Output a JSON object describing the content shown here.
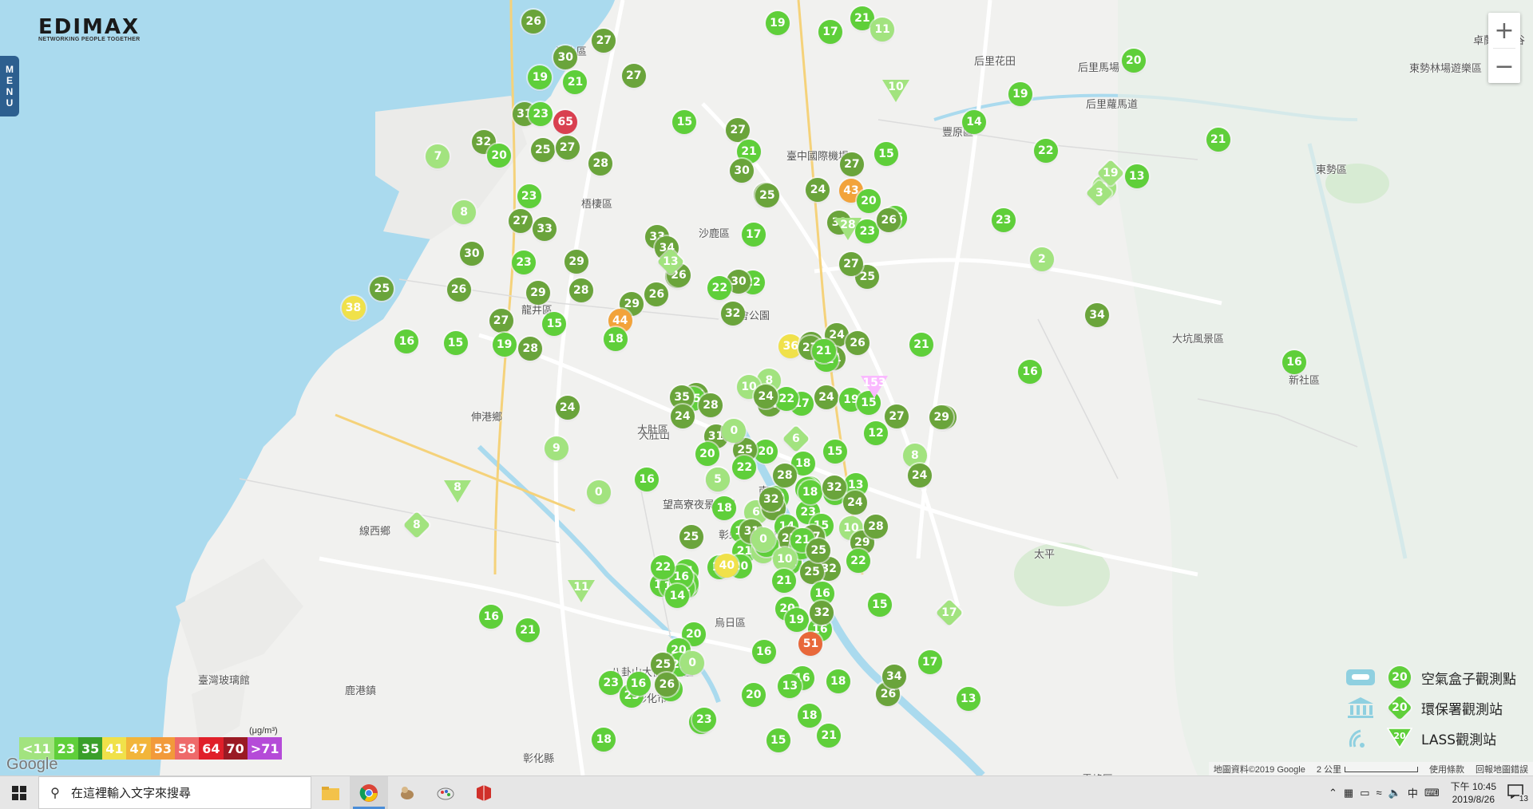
{
  "logo": {
    "brand": "EDIMAX",
    "tagline": "NETWORKING PEOPLE TOGETHER"
  },
  "menu_tab": {
    "label": [
      "M",
      "E",
      "N",
      "U"
    ]
  },
  "zoom": {
    "in": "+",
    "out": "−"
  },
  "places": [
    "清水區",
    "后里花田",
    "后里馬場",
    "后里蘿馬道",
    "卓蘭大峽谷",
    "東勢林場遊樂區",
    "臺中國際機場",
    "梧棲區",
    "沙鹿區",
    "都會公園",
    "大肚山",
    "龍井區",
    "伸港鄉",
    "線西鄉",
    "彰化市",
    "鹿港鎮",
    "臺灣玻璃館",
    "大肚區",
    "望高寮夜景公園",
    "彰虹村 Rainbow Village",
    "東勢區",
    "新社區",
    "大坑風景區",
    "霧峰區",
    "彰化縣",
    "南",
    "太平",
    "八卦山大佛風景區",
    "烏日區",
    "豐原區"
  ],
  "legend": {
    "items": [
      {
        "label": "空氣盒子觀測點",
        "value": "20"
      },
      {
        "label": "環保署觀測站",
        "value": "20"
      },
      {
        "label": "LASS觀測站",
        "value": "20"
      }
    ]
  },
  "aqi_scale": {
    "unit": "(μg/m³)",
    "levels": [
      {
        "label": "<11",
        "color": "#a2e37f"
      },
      {
        "label": "23",
        "color": "#5fcf3a"
      },
      {
        "label": "35",
        "color": "#3a9f2a"
      },
      {
        "label": "41",
        "color": "#f0e14a"
      },
      {
        "label": "47",
        "color": "#f2b53a"
      },
      {
        "label": "53",
        "color": "#f29a3a"
      },
      {
        "label": "58",
        "color": "#ee6a6a"
      },
      {
        "label": "64",
        "color": "#e0202a"
      },
      {
        "label": "70",
        "color": "#9a1a24"
      },
      {
        "label": ">71",
        "color": "#b54bd8"
      }
    ]
  },
  "google_logo": "Google",
  "attribution": {
    "data": "地圖資料©2019 Google",
    "scale": "2 公里",
    "terms": "使用條款",
    "report": "回報地圖錯誤"
  },
  "markers": [
    {
      "v": "26",
      "c": 3
    },
    {
      "v": "27",
      "c": 3
    },
    {
      "v": "30",
      "c": 3
    },
    {
      "v": "19",
      "c": 2
    },
    {
      "v": "27",
      "c": 3
    },
    {
      "v": "21",
      "c": 2
    },
    {
      "v": "19",
      "c": 2
    },
    {
      "v": "17",
      "c": 2
    },
    {
      "v": "21",
      "c": 2
    },
    {
      "v": "11",
      "c": 1
    },
    {
      "v": "20",
      "c": 2
    },
    {
      "v": "31",
      "c": 3
    },
    {
      "v": "23",
      "c": 2
    },
    {
      "v": "65",
      "c": 8
    },
    {
      "v": "7",
      "c": 1
    },
    {
      "v": "32",
      "c": 3
    },
    {
      "v": "20",
      "c": 2
    },
    {
      "v": "25",
      "c": 3
    },
    {
      "v": "27",
      "c": 3
    },
    {
      "v": "28",
      "c": 3
    },
    {
      "v": "15",
      "c": 2
    },
    {
      "v": "27",
      "c": 3
    },
    {
      "v": "21",
      "c": 2
    },
    {
      "v": "30",
      "c": 3
    },
    {
      "v": "25",
      "c": 3
    },
    {
      "v": "27",
      "c": 3
    },
    {
      "v": "15",
      "c": 2
    },
    {
      "v": "15",
      "c": 2
    },
    {
      "v": "43",
      "c": 5
    },
    {
      "v": "20",
      "c": 2
    },
    {
      "v": "24",
      "c": 3
    },
    {
      "v": "19",
      "c": 2
    },
    {
      "v": "14",
      "c": 2
    },
    {
      "v": "22",
      "c": 2
    },
    {
      "v": "21",
      "c": 2
    },
    {
      "v": "13",
      "c": 2
    },
    {
      "v": "0",
      "c": 1
    },
    {
      "v": "8",
      "c": 1
    },
    {
      "v": "23",
      "c": 2
    },
    {
      "v": "25",
      "c": 3
    },
    {
      "v": "27",
      "c": 3
    },
    {
      "v": "33",
      "c": 3
    },
    {
      "v": "33",
      "c": 3
    },
    {
      "v": "34",
      "c": 3
    },
    {
      "v": "17",
      "c": 2
    },
    {
      "v": "23",
      "c": 2
    },
    {
      "v": "26",
      "c": 3
    },
    {
      "v": "32",
      "c": 3
    },
    {
      "v": "25",
      "c": 3
    },
    {
      "v": "23",
      "c": 2
    },
    {
      "v": "30",
      "c": 3
    },
    {
      "v": "23",
      "c": 2
    },
    {
      "v": "29",
      "c": 3
    },
    {
      "v": "28",
      "c": 3
    },
    {
      "v": "30",
      "c": 3
    },
    {
      "v": "22",
      "c": 2
    },
    {
      "v": "30",
      "c": 3
    },
    {
      "v": "22",
      "c": 2
    },
    {
      "v": "27",
      "c": 3
    },
    {
      "v": "2",
      "c": 1
    },
    {
      "v": "26",
      "c": 3
    },
    {
      "v": "29",
      "c": 3
    },
    {
      "v": "25",
      "c": 3
    },
    {
      "v": "38",
      "c": 4
    },
    {
      "v": "26",
      "c": 3
    },
    {
      "v": "26",
      "c": 3
    },
    {
      "v": "29",
      "c": 3
    },
    {
      "v": "27",
      "c": 3
    },
    {
      "v": "44",
      "c": 5
    },
    {
      "v": "32",
      "c": 3
    },
    {
      "v": "34",
      "c": 3
    },
    {
      "v": "16",
      "c": 2
    },
    {
      "v": "15",
      "c": 2
    },
    {
      "v": "19",
      "c": 2
    },
    {
      "v": "28",
      "c": 3
    },
    {
      "v": "15",
      "c": 2
    },
    {
      "v": "18",
      "c": 2
    },
    {
      "v": "36",
      "c": 4
    },
    {
      "v": "28",
      "c": 3
    },
    {
      "v": "24",
      "c": 3
    },
    {
      "v": "26",
      "c": 3
    },
    {
      "v": "31",
      "c": 3
    },
    {
      "v": "21",
      "c": 2
    },
    {
      "v": "16",
      "c": 2
    },
    {
      "v": "16",
      "c": 2
    },
    {
      "v": "24",
      "c": 3
    },
    {
      "v": "26",
      "c": 3
    },
    {
      "v": "15",
      "c": 2
    },
    {
      "v": "8",
      "c": 1
    },
    {
      "v": "34",
      "c": 3
    },
    {
      "v": "35",
      "c": 3
    },
    {
      "v": "28",
      "c": 3
    },
    {
      "v": "17",
      "c": 2
    },
    {
      "v": "24",
      "c": 3
    },
    {
      "v": "19",
      "c": 2
    },
    {
      "v": "15",
      "c": 2
    },
    {
      "v": "27",
      "c": 3
    },
    {
      "v": "25",
      "c": 3
    },
    {
      "v": "29",
      "c": 3
    },
    {
      "v": "9",
      "c": 1
    },
    {
      "v": "24",
      "c": 3
    },
    {
      "v": "31",
      "c": 3
    },
    {
      "v": "20",
      "c": 2
    },
    {
      "v": "25",
      "c": 3
    },
    {
      "v": "20",
      "c": 2
    },
    {
      "v": "22",
      "c": 2
    },
    {
      "v": "15",
      "c": 2
    },
    {
      "v": "12",
      "c": 2
    },
    {
      "v": "8",
      "c": 1
    },
    {
      "v": "18",
      "c": 2
    },
    {
      "v": "22",
      "c": 2
    },
    {
      "v": "16",
      "c": 2
    },
    {
      "v": "0",
      "c": 1
    },
    {
      "v": "25",
      "c": 3
    },
    {
      "v": "5",
      "c": 1
    },
    {
      "v": "28",
      "c": 3
    },
    {
      "v": "23",
      "c": 2
    },
    {
      "v": "21",
      "c": 2
    },
    {
      "v": "10",
      "c": 1
    },
    {
      "v": "24",
      "c": 3
    },
    {
      "v": "13",
      "c": 2
    },
    {
      "v": "19",
      "c": 2
    },
    {
      "v": "23",
      "c": 2
    },
    {
      "v": "6",
      "c": 1
    },
    {
      "v": "18",
      "c": 2
    },
    {
      "v": "25",
      "c": 3
    },
    {
      "v": "32",
      "c": 3
    },
    {
      "v": "15",
      "c": 2
    },
    {
      "v": "16",
      "c": 2
    },
    {
      "v": "21",
      "c": 2
    },
    {
      "v": "14",
      "c": 2
    },
    {
      "v": "31",
      "c": 3
    },
    {
      "v": "8",
      "c": 1
    },
    {
      "v": "27",
      "c": 3
    },
    {
      "v": "22",
      "c": 2
    },
    {
      "v": "9",
      "c": 1
    },
    {
      "v": "21",
      "c": 2
    },
    {
      "v": "23",
      "c": 2
    },
    {
      "v": "16",
      "c": 2
    },
    {
      "v": "32",
      "c": 3
    },
    {
      "v": "32",
      "c": 3
    },
    {
      "v": "24",
      "c": 3
    },
    {
      "v": "29",
      "c": 3
    },
    {
      "v": "28",
      "c": 3
    },
    {
      "v": "22",
      "c": 2
    },
    {
      "v": "27",
      "c": 3
    },
    {
      "v": "25",
      "c": 3
    },
    {
      "v": "21",
      "c": 2
    },
    {
      "v": "20",
      "c": 2
    },
    {
      "v": "21",
      "c": 2
    },
    {
      "v": "24",
      "c": 3
    },
    {
      "v": "10",
      "c": 1
    },
    {
      "v": "0",
      "c": 1
    },
    {
      "v": "21",
      "c": 2
    },
    {
      "v": "20",
      "c": 2
    },
    {
      "v": "19",
      "c": 2
    },
    {
      "v": "16",
      "c": 2
    },
    {
      "v": "16",
      "c": 2
    },
    {
      "v": "51",
      "c": 6
    },
    {
      "v": "15",
      "c": 2
    },
    {
      "v": "18",
      "c": 2
    },
    {
      "v": "18",
      "c": 2
    },
    {
      "v": "17",
      "c": 2
    },
    {
      "v": "20",
      "c": 2
    },
    {
      "v": "16",
      "c": 2
    },
    {
      "v": "16",
      "c": 2
    },
    {
      "v": "21",
      "c": 2
    },
    {
      "v": "19",
      "c": 2
    },
    {
      "v": "16",
      "c": 2
    },
    {
      "v": "40",
      "c": 4
    },
    {
      "v": "14",
      "c": 2
    },
    {
      "v": "22",
      "c": 2
    },
    {
      "v": "20",
      "c": 2
    },
    {
      "v": "18",
      "c": 2
    },
    {
      "v": "16",
      "c": 2
    },
    {
      "v": "16",
      "c": 2
    },
    {
      "v": "15",
      "c": 2
    },
    {
      "v": "18",
      "c": 2
    },
    {
      "v": "17",
      "c": 2
    },
    {
      "v": "16",
      "c": 2
    },
    {
      "v": "21",
      "c": 2
    },
    {
      "v": "13",
      "c": 2
    },
    {
      "v": "18",
      "c": 2
    },
    {
      "v": "16",
      "c": 2
    },
    {
      "v": "21",
      "c": 2
    },
    {
      "v": "23",
      "c": 2
    },
    {
      "v": "20",
      "c": 2
    },
    {
      "v": "21",
      "c": 2
    },
    {
      "v": "19",
      "c": 2
    },
    {
      "v": "13",
      "c": 2
    },
    {
      "v": "0",
      "c": 1
    },
    {
      "v": "25",
      "c": 3
    },
    {
      "v": "23",
      "c": 2
    },
    {
      "v": "23",
      "c": 2
    },
    {
      "v": "26",
      "c": 3
    },
    {
      "v": "32",
      "c": 3
    },
    {
      "v": "26",
      "c": 3
    },
    {
      "v": "34",
      "c": 3
    },
    {
      "v": "21",
      "c": 2
    },
    {
      "v": "16",
      "c": 2
    },
    {
      "v": "25",
      "c": 3
    },
    {
      "v": "25",
      "c": 3
    },
    {
      "v": "18",
      "c": 2
    },
    {
      "v": "0",
      "c": 1
    },
    {
      "v": "22",
      "c": 2
    },
    {
      "v": "10",
      "c": 1
    },
    {
      "v": "24",
      "c": 3
    },
    {
      "v": "12",
      "c": 2
    },
    {
      "v": "27",
      "c": 3
    },
    {
      "v": "21",
      "c": 2
    }
  ],
  "special_markers": [
    {
      "v": "10",
      "shape": "tri"
    },
    {
      "v": "28",
      "shape": "tri"
    },
    {
      "v": "8",
      "shape": "tri"
    },
    {
      "v": "11",
      "shape": "tri"
    },
    {
      "v": "153",
      "shape": "tri"
    },
    {
      "v": "13",
      "shape": "dia"
    },
    {
      "v": "3",
      "shape": "dia"
    },
    {
      "v": "6",
      "shape": "dia"
    },
    {
      "v": "8",
      "shape": "dia"
    },
    {
      "v": "17",
      "shape": "dia"
    },
    {
      "v": "19",
      "shape": "dia"
    }
  ],
  "taskbar": {
    "search_placeholder": "在這裡輸入文字來搜尋",
    "apps": [
      "file-explorer-icon",
      "chrome-icon",
      "app-icon-bird",
      "app-icon-paint",
      "app-icon-red"
    ],
    "tray": {
      "ime": "中",
      "time": "下午 10:45",
      "date": "2019/8/26",
      "notifications": "13"
    }
  }
}
